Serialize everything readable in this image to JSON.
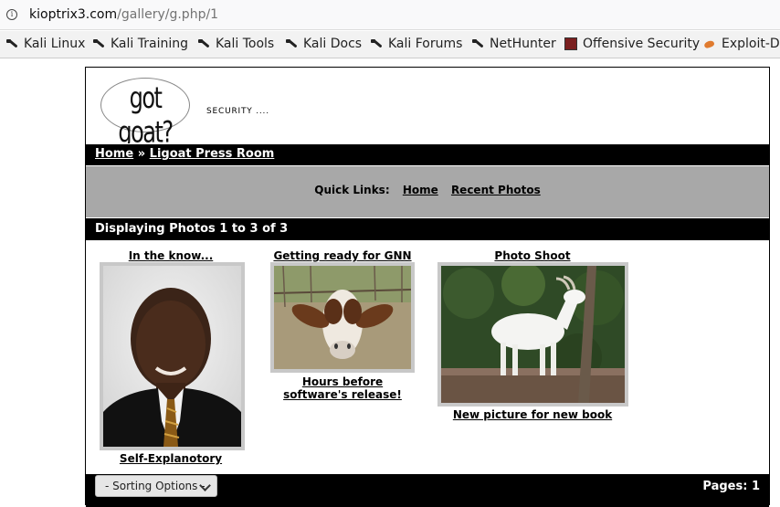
{
  "browser": {
    "url_host": "kioptrix3.com",
    "url_path": "/gallery/g.php/1",
    "bookmarks": [
      {
        "label": "Kali Linux",
        "icon": "kali-dragon-icon"
      },
      {
        "label": "Kali Training",
        "icon": "kali-dragon-icon"
      },
      {
        "label": "Kali Tools",
        "icon": "kali-dragon-icon"
      },
      {
        "label": "Kali Docs",
        "icon": "kali-dragon-icon"
      },
      {
        "label": "Kali Forums",
        "icon": "kali-dragon-icon"
      },
      {
        "label": "NetHunter",
        "icon": "kali-dragon-icon"
      },
      {
        "label": "Offensive Security",
        "icon": "offensive-security-icon"
      },
      {
        "label": "Exploit-D",
        "icon": "exploit-db-icon"
      }
    ]
  },
  "site": {
    "logo_text": "got goat?",
    "tagline": "SECURITY ...."
  },
  "breadcrumb": {
    "home": "Home",
    "separator": "»",
    "current": "Ligoat Press Room"
  },
  "quick_links": {
    "label": "Quick Links:",
    "links": [
      "Home",
      "Recent Photos"
    ]
  },
  "display_text": "Displaying Photos 1 to 3 of 3",
  "photos": [
    {
      "title": "In the know...",
      "caption": "Self-Explanotory",
      "image": "man-portrait"
    },
    {
      "title": "Getting ready for GNN",
      "caption": "Hours before software's release!",
      "image": "goat-closeup"
    },
    {
      "title": "Photo Shoot",
      "caption": "New picture for new book",
      "image": "white-goat"
    }
  ],
  "footer": {
    "sorting_label": "- Sorting Options -",
    "pages_text": "Pages: 1"
  }
}
